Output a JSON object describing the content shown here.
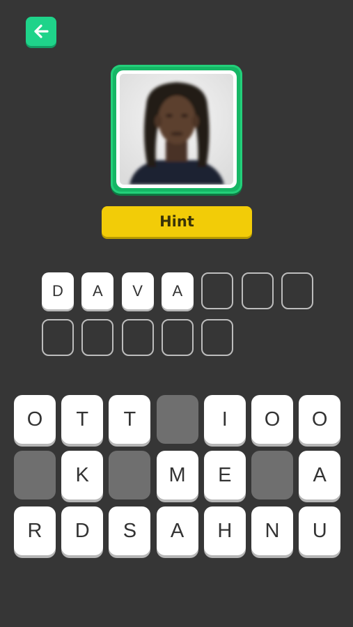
{
  "header": {
    "back_icon": "arrow-left-icon",
    "accent": "#1fd38a"
  },
  "puzzle": {
    "photo_icon": "player-portrait",
    "hint_label": "Hint",
    "answer_slots": [
      "D",
      "A",
      "V",
      "A",
      "",
      "",
      "",
      "",
      "",
      "",
      "",
      ""
    ]
  },
  "keyboard": {
    "rows": [
      [
        "O",
        "T",
        "T",
        "",
        "I",
        "O",
        "O"
      ],
      [
        "",
        "K",
        "",
        "M",
        "E",
        "",
        "A"
      ],
      [
        "R",
        "D",
        "S",
        "A",
        "H",
        "N",
        "U"
      ]
    ],
    "used_keys": [
      [
        0,
        3
      ],
      [
        1,
        0
      ],
      [
        1,
        2
      ],
      [
        1,
        5
      ]
    ]
  }
}
